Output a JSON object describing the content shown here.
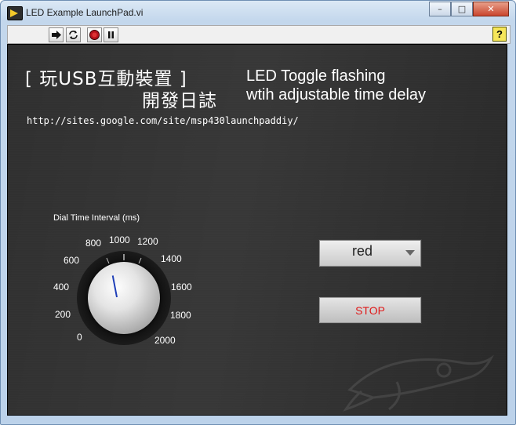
{
  "window": {
    "title": "LED Example LaunchPad.vi",
    "controls": {
      "minimize": "–",
      "maximize": "□",
      "close": "✕"
    }
  },
  "toolbar": {
    "buttons": [
      {
        "name": "run-arrow-icon",
        "glyph": "➜"
      },
      {
        "name": "run-continuously-icon",
        "glyph": "↻"
      },
      {
        "name": "abort-icon",
        "glyph": "●"
      },
      {
        "name": "pause-icon",
        "glyph": "‖"
      }
    ],
    "help_glyph": "?"
  },
  "panel": {
    "title_line1": "[ 玩USB互動裝置 ]",
    "title_line2": "開發日誌",
    "desc_line1": "LED Toggle flashing",
    "desc_line2": "wtih adjustable time delay",
    "url": "http://sites.google.com/site/msp430launchpaddiy/"
  },
  "dial": {
    "label": "Dial Time Interval (ms)",
    "value": 920,
    "min": 0,
    "max": 2000,
    "ticks": [
      "0",
      "200",
      "400",
      "600",
      "800",
      "1000",
      "1200",
      "1400",
      "1600",
      "1800",
      "2000"
    ]
  },
  "color_ring": {
    "value": "red"
  },
  "stop": {
    "label": "STOP",
    "color": "#e01919"
  }
}
